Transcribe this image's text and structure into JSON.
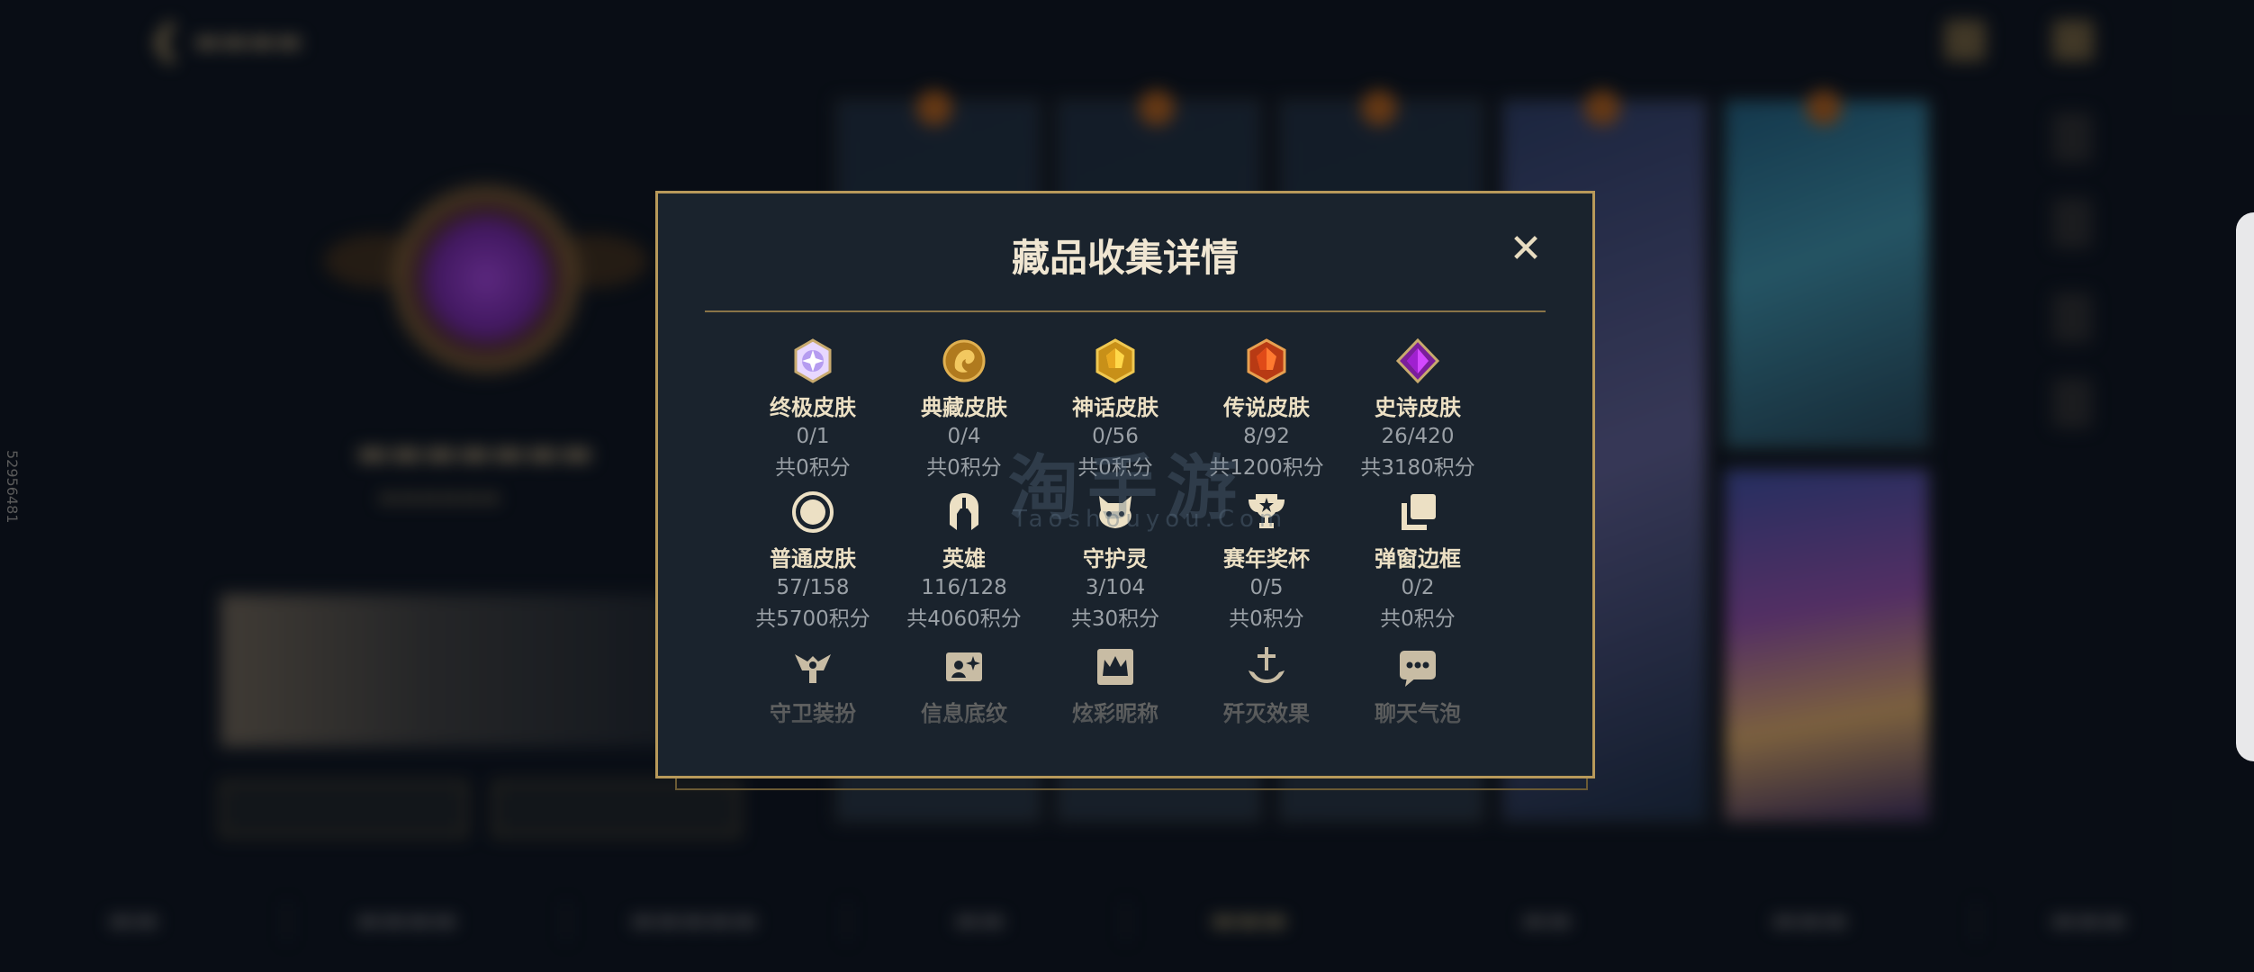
{
  "colors": {
    "gold": "#c8aa6e",
    "modal_bg": "#1a232d",
    "border": "#b8995a",
    "label": "#ece0c4",
    "muted": "#9aa0a6"
  },
  "background": {
    "watermark_side_id": "52956481"
  },
  "modal": {
    "title": "藏品收集详情",
    "close_label": "✕",
    "items": [
      {
        "icon": "ultimate-skin-icon",
        "label": "终极皮肤",
        "count": "0/1",
        "points": "共0积分"
      },
      {
        "icon": "prestige-skin-icon",
        "label": "典藏皮肤",
        "count": "0/4",
        "points": "共0积分"
      },
      {
        "icon": "mythic-skin-icon",
        "label": "神话皮肤",
        "count": "0/56",
        "points": "共0积分"
      },
      {
        "icon": "legendary-skin-icon",
        "label": "传说皮肤",
        "count": "8/92",
        "points": "共1200积分"
      },
      {
        "icon": "epic-skin-icon",
        "label": "史诗皮肤",
        "count": "26/420",
        "points": "共3180积分"
      },
      {
        "icon": "standard-skin-icon",
        "label": "普通皮肤",
        "count": "57/158",
        "points": "共5700积分"
      },
      {
        "icon": "champion-helmet-icon",
        "label": "英雄",
        "count": "116/128",
        "points": "共4060积分"
      },
      {
        "icon": "little-legend-icon",
        "label": "守护灵",
        "count": "3/104",
        "points": "共30积分"
      },
      {
        "icon": "trophy-icon",
        "label": "赛年奖杯",
        "count": "0/5",
        "points": "共0积分"
      },
      {
        "icon": "popup-frame-icon",
        "label": "弹窗边框",
        "count": "0/2",
        "points": "共0积分"
      },
      {
        "icon": "ward-skin-icon",
        "label": "守卫装扮"
      },
      {
        "icon": "profile-banner-icon",
        "label": "信息底纹"
      },
      {
        "icon": "colorful-name-icon",
        "label": "炫彩昵称"
      },
      {
        "icon": "finisher-effect-icon",
        "label": "歼灭效果"
      },
      {
        "icon": "chat-bubble-icon",
        "label": "聊天气泡"
      }
    ]
  },
  "watermark": {
    "main": "淘手游",
    "sub": "Taoshouyou.Com"
  }
}
